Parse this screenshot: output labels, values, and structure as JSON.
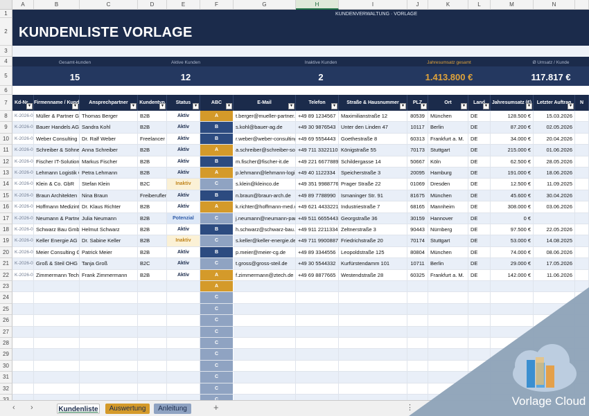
{
  "columns": [
    "A",
    "B",
    "C",
    "D",
    "E",
    "F",
    "G",
    "H",
    "I",
    "J",
    "K",
    "L",
    "M",
    "N"
  ],
  "active_column": "H",
  "header": {
    "subtitle": "KUNDENVERWALTUNG · Vorlage",
    "title": "KUNDENLISTE VORLAGE"
  },
  "kpis": [
    {
      "label": "Gesamt-kunden",
      "value": "15"
    },
    {
      "label": "Aktive Kunden",
      "value": "12"
    },
    {
      "label": "Inaktive Kunden",
      "value": "2"
    },
    {
      "label": "Jahresumsatz gesamt",
      "value": "1.413.800 €",
      "accent": true
    },
    {
      "label": "Ø Umsatz / Kunde",
      "value": "117.817 €"
    }
  ],
  "table_headers": [
    "Kd-Nr.",
    "Firmenname / Kunde",
    "Ansprechpartner",
    "Kundentyp",
    "Status",
    "ABC",
    "E-Mail",
    "Telefon",
    "Straße & Hausnummer",
    "PLZ",
    "Ort",
    "Land",
    "Jahresumsatz (€)",
    "Letzter Auftrag",
    "N"
  ],
  "rows": [
    {
      "id": "K-2026-001",
      "name": "Müller & Partner GmbH",
      "contact": "Thomas Berger",
      "type": "B2B",
      "status": "Aktiv",
      "abc": "A",
      "email": "t.berger@mueller-partner.de",
      "phone": "+49 89 1234567",
      "street": "Maximilianstraße 12",
      "plz": "80539",
      "city": "München",
      "land": "DE",
      "revenue": "128.500 €",
      "last": "15.03.2026"
    },
    {
      "id": "K-2026-002",
      "name": "Bauer Handels AG",
      "contact": "Sandra Kohl",
      "type": "B2B",
      "status": "Aktiv",
      "abc": "B",
      "email": "s.kohl@bauer-ag.de",
      "phone": "+49 30 9876543",
      "street": "Unter den Linden 47",
      "plz": "10117",
      "city": "Berlin",
      "land": "DE",
      "revenue": "87.200 €",
      "last": "02.05.2026"
    },
    {
      "id": "K-2026-003",
      "name": "Weber Consulting",
      "contact": "Dr. Ralf Weber",
      "type": "Freelancer",
      "status": "Aktiv",
      "abc": "B",
      "email": "r.weber@weber-consulting.de",
      "phone": "+49 69 5554443",
      "street": "Goethestraße 8",
      "plz": "60313",
      "city": "Frankfurt a. M.",
      "land": "DE",
      "revenue": "34.000 €",
      "last": "20.04.2026"
    },
    {
      "id": "K-2026-004",
      "name": "Schreiber & Söhne KG",
      "contact": "Anna Schreiber",
      "type": "B2B",
      "status": "Aktiv",
      "abc": "A",
      "email": "a.schreiber@schreiber-soehne.de",
      "phone": "+49 711 3322110",
      "street": "Königstraße 55",
      "plz": "70173",
      "city": "Stuttgart",
      "land": "DE",
      "revenue": "215.000 €",
      "last": "01.06.2026"
    },
    {
      "id": "K-2026-005",
      "name": "Fischer IT-Solutions",
      "contact": "Markus Fischer",
      "type": "B2B",
      "status": "Aktiv",
      "abc": "B",
      "email": "m.fischer@fischer-it.de",
      "phone": "+49 221 6677889",
      "street": "Schildergasse 14",
      "plz": "50667",
      "city": "Köln",
      "land": "DE",
      "revenue": "62.500 €",
      "last": "28.05.2026"
    },
    {
      "id": "K-2026-006",
      "name": "Lehmann Logistik GmbH",
      "contact": "Petra Lehmann",
      "type": "B2B",
      "status": "Aktiv",
      "abc": "A",
      "email": "p.lehmann@lehmann-logistik.de",
      "phone": "+49 40 1122334",
      "street": "Speicherstraße 3",
      "plz": "20095",
      "city": "Hamburg",
      "land": "DE",
      "revenue": "191.000 €",
      "last": "18.06.2026"
    },
    {
      "id": "K-2026-007",
      "name": "Klein & Co. GbR",
      "contact": "Stefan Klein",
      "type": "B2C",
      "status": "Inaktiv",
      "abc": "C",
      "email": "s.klein@kleinco.de",
      "phone": "+49 351 9988776",
      "street": "Prager Straße 22",
      "plz": "01069",
      "city": "Dresden",
      "land": "DE",
      "revenue": "12.500 €",
      "last": "11.09.2025"
    },
    {
      "id": "K-2026-008",
      "name": "Braun Architekten",
      "contact": "Nina Braun",
      "type": "Freiberufler",
      "status": "Aktiv",
      "abc": "B",
      "email": "n.braun@braun-arch.de",
      "phone": "+49 89 7788990",
      "street": "Ismaninger Str. 91",
      "plz": "81675",
      "city": "München",
      "land": "DE",
      "revenue": "45.600 €",
      "last": "30.04.2026"
    },
    {
      "id": "K-2026-009",
      "name": "Hoffmann Medizintechnik",
      "contact": "Dr. Klaus Richter",
      "type": "B2B",
      "status": "Aktiv",
      "abc": "A",
      "email": "k.richter@hoffmann-med.de",
      "phone": "+49 621 4433221",
      "street": "Industriestraße 7",
      "plz": "68165",
      "city": "Mannheim",
      "land": "DE",
      "revenue": "308.000 €",
      "last": "03.06.2026"
    },
    {
      "id": "K-2026-010",
      "name": "Neumann & Partner",
      "contact": "Julia Neumann",
      "type": "B2B",
      "status": "Potenzial",
      "abc": "C",
      "email": "j.neumann@neumann-partner.de",
      "phone": "+49 511 6655443",
      "street": "Georgstraße 36",
      "plz": "30159",
      "city": "Hannover",
      "land": "DE",
      "revenue": "0 €",
      "last": ""
    },
    {
      "id": "K-2026-011",
      "name": "Schwarz Bau GmbH",
      "contact": "Helmut Schwarz",
      "type": "B2B",
      "status": "Aktiv",
      "abc": "B",
      "email": "h.schwarz@schwarz-bau.de",
      "phone": "+49 911 2211334",
      "street": "Zeltnerstraße 3",
      "plz": "90443",
      "city": "Nürnberg",
      "land": "DE",
      "revenue": "97.500 €",
      "last": "22.05.2026"
    },
    {
      "id": "K-2026-012",
      "name": "Keller Energie AG",
      "contact": "Dr. Sabine Keller",
      "type": "B2B",
      "status": "Inaktiv",
      "abc": "C",
      "email": "s.keller@keller-energie.de",
      "phone": "+49 711 9900887",
      "street": "Friedrichstraße 20",
      "plz": "70174",
      "city": "Stuttgart",
      "land": "DE",
      "revenue": "53.000 €",
      "last": "14.08.2025"
    },
    {
      "id": "K-2026-013",
      "name": "Meier Consulting Group",
      "contact": "Patrick Meier",
      "type": "B2B",
      "status": "Aktiv",
      "abc": "B",
      "email": "p.meier@meier-cg.de",
      "phone": "+49 89 3344556",
      "street": "Leopoldstraße 125",
      "plz": "80804",
      "city": "München",
      "land": "DE",
      "revenue": "74.000 €",
      "last": "08.06.2026"
    },
    {
      "id": "K-2026-014",
      "name": "Groß & Steil OHG",
      "contact": "Tanja Groß",
      "type": "B2C",
      "status": "Aktiv",
      "abc": "C",
      "email": "t.gross@gross-steil.de",
      "phone": "+49 30 5544332",
      "street": "Kurfürstendamm 101",
      "plz": "10711",
      "city": "Berlin",
      "land": "DE",
      "revenue": "29.000 €",
      "last": "17.05.2026"
    },
    {
      "id": "K-2026-015",
      "name": "Zimmermann Tech GmbH",
      "contact": "Frank Zimmermann",
      "type": "B2B",
      "status": "Aktiv",
      "abc": "A",
      "email": "f.zimmermann@ztech.de",
      "phone": "+49 69 8877665",
      "street": "Westendstraße 28",
      "plz": "60325",
      "city": "Frankfurt a. M.",
      "land": "DE",
      "revenue": "142.000 €",
      "last": "11.06.2026"
    }
  ],
  "empty_abc": "C",
  "extra_abc_row": "A",
  "sheet_tabs": [
    {
      "label": "Kundenliste",
      "active": true
    },
    {
      "label": "Auswertung",
      "color": "#d49a2a"
    },
    {
      "label": "Anleitung",
      "color": "#8fa3c2"
    }
  ],
  "add_sheet": "+",
  "tab_nav": {
    "prev": "‹",
    "next": "›"
  },
  "watermark": "Vorlage Cloud",
  "colors": {
    "navy": "#1b2b4b",
    "navy2": "#243860",
    "gold": "#e0a33a",
    "abc_a": "#d49a2a",
    "abc_b": "#2c4b80",
    "abc_c": "#8fa3c2",
    "status_aktiv": "#1b2b4b",
    "status_inaktiv": "#c0851d",
    "status_potenzial": "#2f5ba8",
    "row_alt": "#e9eff8"
  }
}
